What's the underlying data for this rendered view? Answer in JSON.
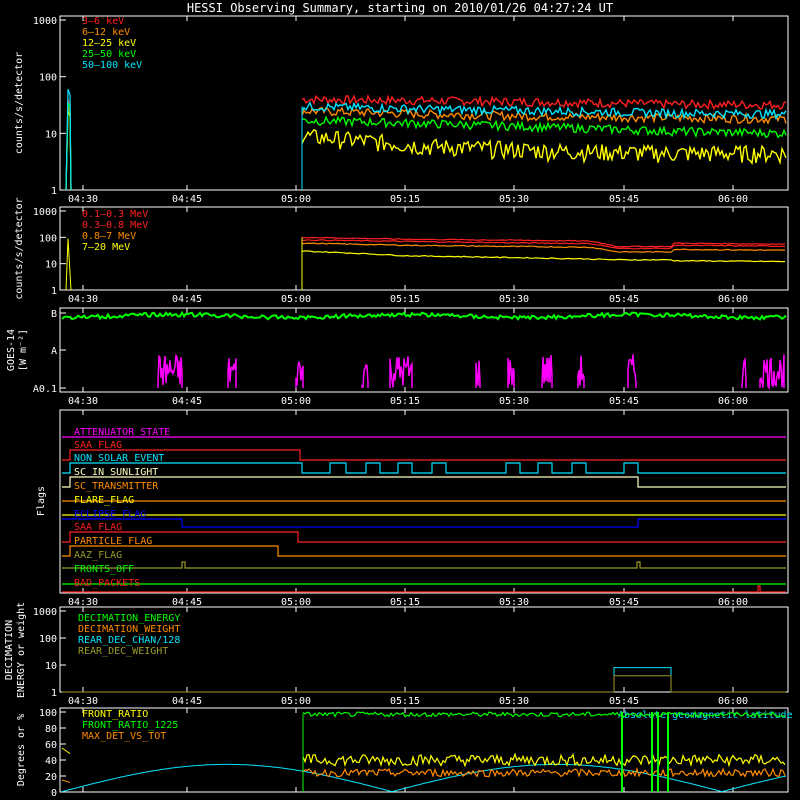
{
  "title": "HESSI Observing Summary, starting on 2010/01/26 04:27:24 UT",
  "time_axis": {
    "start": "04:27:24",
    "end": "06:08:00",
    "ticks": [
      "04:30",
      "04:45",
      "05:00",
      "05:15",
      "05:30",
      "05:45",
      "06:00"
    ]
  },
  "panels": {
    "lightcurve": {
      "ylabel": "counts/s/detector",
      "yticks": [
        "1",
        "10",
        "100",
        "1000"
      ],
      "legend": [
        {
          "label": "3—6 keV",
          "color": "#ff2020"
        },
        {
          "label": "6—12 keV",
          "color": "#ff8c00"
        },
        {
          "label": "12—25 keV",
          "color": "#ffff00"
        },
        {
          "label": "25—50 keV",
          "color": "#00ff00"
        },
        {
          "label": "50—100 keV",
          "color": "#00e5ff"
        }
      ]
    },
    "gamma": {
      "ylabel": "counts/s/detector",
      "yticks": [
        "1",
        "10",
        "100",
        "1000"
      ],
      "legend": [
        {
          "label": "0.1—0.3 MeV",
          "color": "#ff2020"
        },
        {
          "label": "0.3—0.8 MeV",
          "color": "#ff2020"
        },
        {
          "label": "0.8—7 MeV",
          "color": "#ff8c00"
        },
        {
          "label": "7—20 MeV",
          "color": "#ffff00"
        }
      ]
    },
    "goes": {
      "ylabel1": "GOES-14",
      "ylabel2": "[W m⁻²]",
      "yticks": [
        "A0.1",
        "A",
        "B"
      ],
      "colors": {
        "long": "#00ff00",
        "short": "#ff00ff"
      }
    },
    "flags": {
      "ylabel": "Flags",
      "items": [
        {
          "label": "ATTENUATOR_STATE",
          "color": "#ff00ff"
        },
        {
          "label": "SAA_FLAG",
          "color": "#ff2020"
        },
        {
          "label": "NON_SOLAR_EVENT",
          "color": "#00e5ff"
        },
        {
          "label": "SC_IN_SUNLIGHT",
          "color": "#ffffc0"
        },
        {
          "label": "SC_TRANSMITTER",
          "color": "#ff8c00"
        },
        {
          "label": "FLARE_FLAG",
          "color": "#ffff00"
        },
        {
          "label": "ECLIPSE_FLAG",
          "color": "#0000ff"
        },
        {
          "label": "SAA_FLAG",
          "color": "#ff2020"
        },
        {
          "label": "PARTICLE_FLAG",
          "color": "#ff8c00"
        },
        {
          "label": "AAZ_FLAG",
          "color": "#9a9a2a"
        },
        {
          "label": "FRONTS_OFF",
          "color": "#00ff00"
        },
        {
          "label": "BAD_PACKETS",
          "color": "#ff2020"
        }
      ]
    },
    "decimation": {
      "ylabel1": "DECIMATION",
      "ylabel2": "ENERGY or weight",
      "yticks": [
        "1",
        "10",
        "100",
        "1000"
      ],
      "legend": [
        {
          "label": "DECIMATION_ENERGY",
          "color": "#00ff00"
        },
        {
          "label": "DECIMATION_WEIGHT",
          "color": "#ff8c00"
        },
        {
          "label": "REAR_DEC_CHAN/128",
          "color": "#00e5ff"
        },
        {
          "label": "REAR_DEC_WEIGHT",
          "color": "#9a9a2a"
        }
      ]
    },
    "ratio": {
      "ylabel": "Degrees or %",
      "yticks": [
        "0",
        "20",
        "40",
        "60",
        "80",
        "100"
      ],
      "legend": [
        {
          "label": "FRONT_RATIO",
          "color": "#ffff00"
        },
        {
          "label": "FRONT_RATIO_1225",
          "color": "#00ff00"
        },
        {
          "label": "MAX_DET_VS_TOT",
          "color": "#ff8c00"
        }
      ],
      "note": "Absolute geomagnetic latitude"
    }
  },
  "chart_data": [
    {
      "type": "line",
      "title": "HESSI Observing Summary, starting on 2010/01/26 04:27:24 UT",
      "ylabel": "counts/s/detector",
      "yscale": "log",
      "ylim": [
        1,
        1000
      ],
      "x": [
        "04:27:24",
        "05:00:40",
        "05:15",
        "05:30",
        "05:45",
        "06:08"
      ],
      "series": [
        {
          "name": "3—6 keV",
          "values": [
            40,
            40,
            38,
            36,
            33,
            32
          ]
        },
        {
          "name": "6—12 keV",
          "values": [
            30,
            25,
            22,
            20,
            19,
            18
          ]
        },
        {
          "name": "12—25 keV",
          "values": [
            25,
            9,
            6,
            5,
            4.5,
            4.5
          ]
        },
        {
          "name": "25—50 keV",
          "values": [
            35,
            17,
            15,
            13,
            11,
            10
          ]
        },
        {
          "name": "50—100 keV",
          "values": [
            60,
            30,
            27,
            25,
            23,
            22
          ]
        }
      ]
    },
    {
      "type": "line",
      "ylabel": "counts/s/detector",
      "yscale": "log",
      "ylim": [
        1,
        1000
      ],
      "x": [
        "05:00:40",
        "05:15",
        "05:30",
        "05:40",
        "05:45",
        "05:50",
        "06:08"
      ],
      "series": [
        {
          "name": "0.1—0.3 MeV",
          "values": [
            100,
            85,
            78,
            72,
            45,
            60,
            55
          ]
        },
        {
          "name": "0.3—0.8 MeV",
          "values": [
            80,
            70,
            62,
            58,
            38,
            50,
            46
          ]
        },
        {
          "name": "0.8—7 MeV",
          "values": [
            60,
            50,
            45,
            42,
            28,
            35,
            32
          ]
        },
        {
          "name": "7—20 MeV",
          "values": [
            30,
            20,
            17,
            15,
            14,
            13,
            12
          ]
        }
      ]
    },
    {
      "type": "line",
      "ylabel": "GOES-14 [W m⁻²]",
      "yscale": "log",
      "yticks": [
        "A0.1",
        "A",
        "B"
      ],
      "series": [
        {
          "name": "long",
          "values": [
            "B",
            "B",
            "B"
          ]
        },
        {
          "name": "short",
          "values": [
            "A0.1",
            "A0.1",
            "A0.1"
          ]
        }
      ]
    },
    {
      "type": "line",
      "ylabel": "DECIMATION ENERGY or weight",
      "yscale": "log",
      "ylim": [
        1,
        1000
      ],
      "series": [
        {
          "name": "REAR_DEC_CHAN/128",
          "values": [
            1,
            8,
            1
          ]
        },
        {
          "name": "REAR_DEC_WEIGHT",
          "values": [
            1,
            4,
            1
          ]
        }
      ]
    },
    {
      "type": "line",
      "ylabel": "Degrees or %",
      "ylim": [
        0,
        100
      ],
      "series": [
        {
          "name": "FRONT_RATIO",
          "values": [
            50,
            40,
            40,
            40,
            40
          ]
        },
        {
          "name": "FRONT_RATIO_1225",
          "values": [
            60,
            100,
            100,
            100,
            100
          ]
        },
        {
          "name": "MAX_DET_VS_TOT",
          "values": [
            15,
            25,
            25,
            25,
            25
          ]
        }
      ]
    }
  ]
}
